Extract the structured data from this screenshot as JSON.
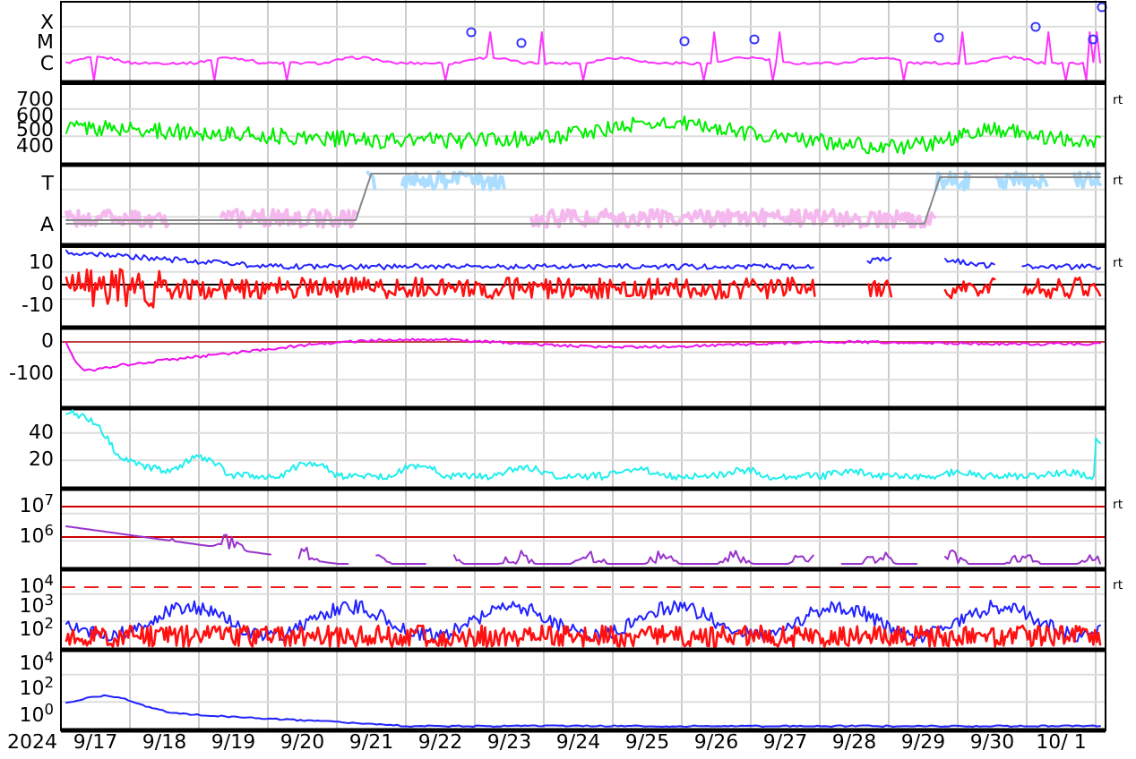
{
  "panels": [
    {
      "kind": "flare",
      "y_labels": [
        "X",
        "M",
        "C"
      ]
    },
    {
      "kind": "speed",
      "y_labels": [
        "700",
        "600",
        "500",
        "400"
      ],
      "right_label": "rt"
    },
    {
      "kind": "sector",
      "y_labels": [
        "T",
        "A"
      ],
      "right_label": "rt"
    },
    {
      "kind": "field",
      "y_labels": [
        "10",
        "0",
        "-10"
      ],
      "right_label": "rt"
    },
    {
      "kind": "dst",
      "y_labels": [
        "0",
        "-100"
      ]
    },
    {
      "kind": "density",
      "y_labels": [
        "40",
        "20"
      ]
    },
    {
      "kind": "electron",
      "y_labels": [
        "10$^{7}$",
        "10$^{6}$"
      ],
      "right_label": "rt"
    },
    {
      "kind": "proton",
      "y_labels": [
        "10$^{4}$",
        "10$^{3}$",
        "10$^{2}$"
      ],
      "right_label": "rt"
    },
    {
      "kind": "ion",
      "y_labels": [
        "10$^{4}$",
        "10$^{2}$",
        "10$^{0}$"
      ]
    }
  ],
  "x_axis": {
    "year": "2024",
    "dates": [
      "9/17",
      "9/18",
      "9/19",
      "9/20",
      "9/21",
      "9/22",
      "9/23",
      "9/24",
      "9/25",
      "9/26",
      "9/27",
      "9/28",
      "9/29",
      "9/30",
      "10/ 1"
    ]
  }
}
